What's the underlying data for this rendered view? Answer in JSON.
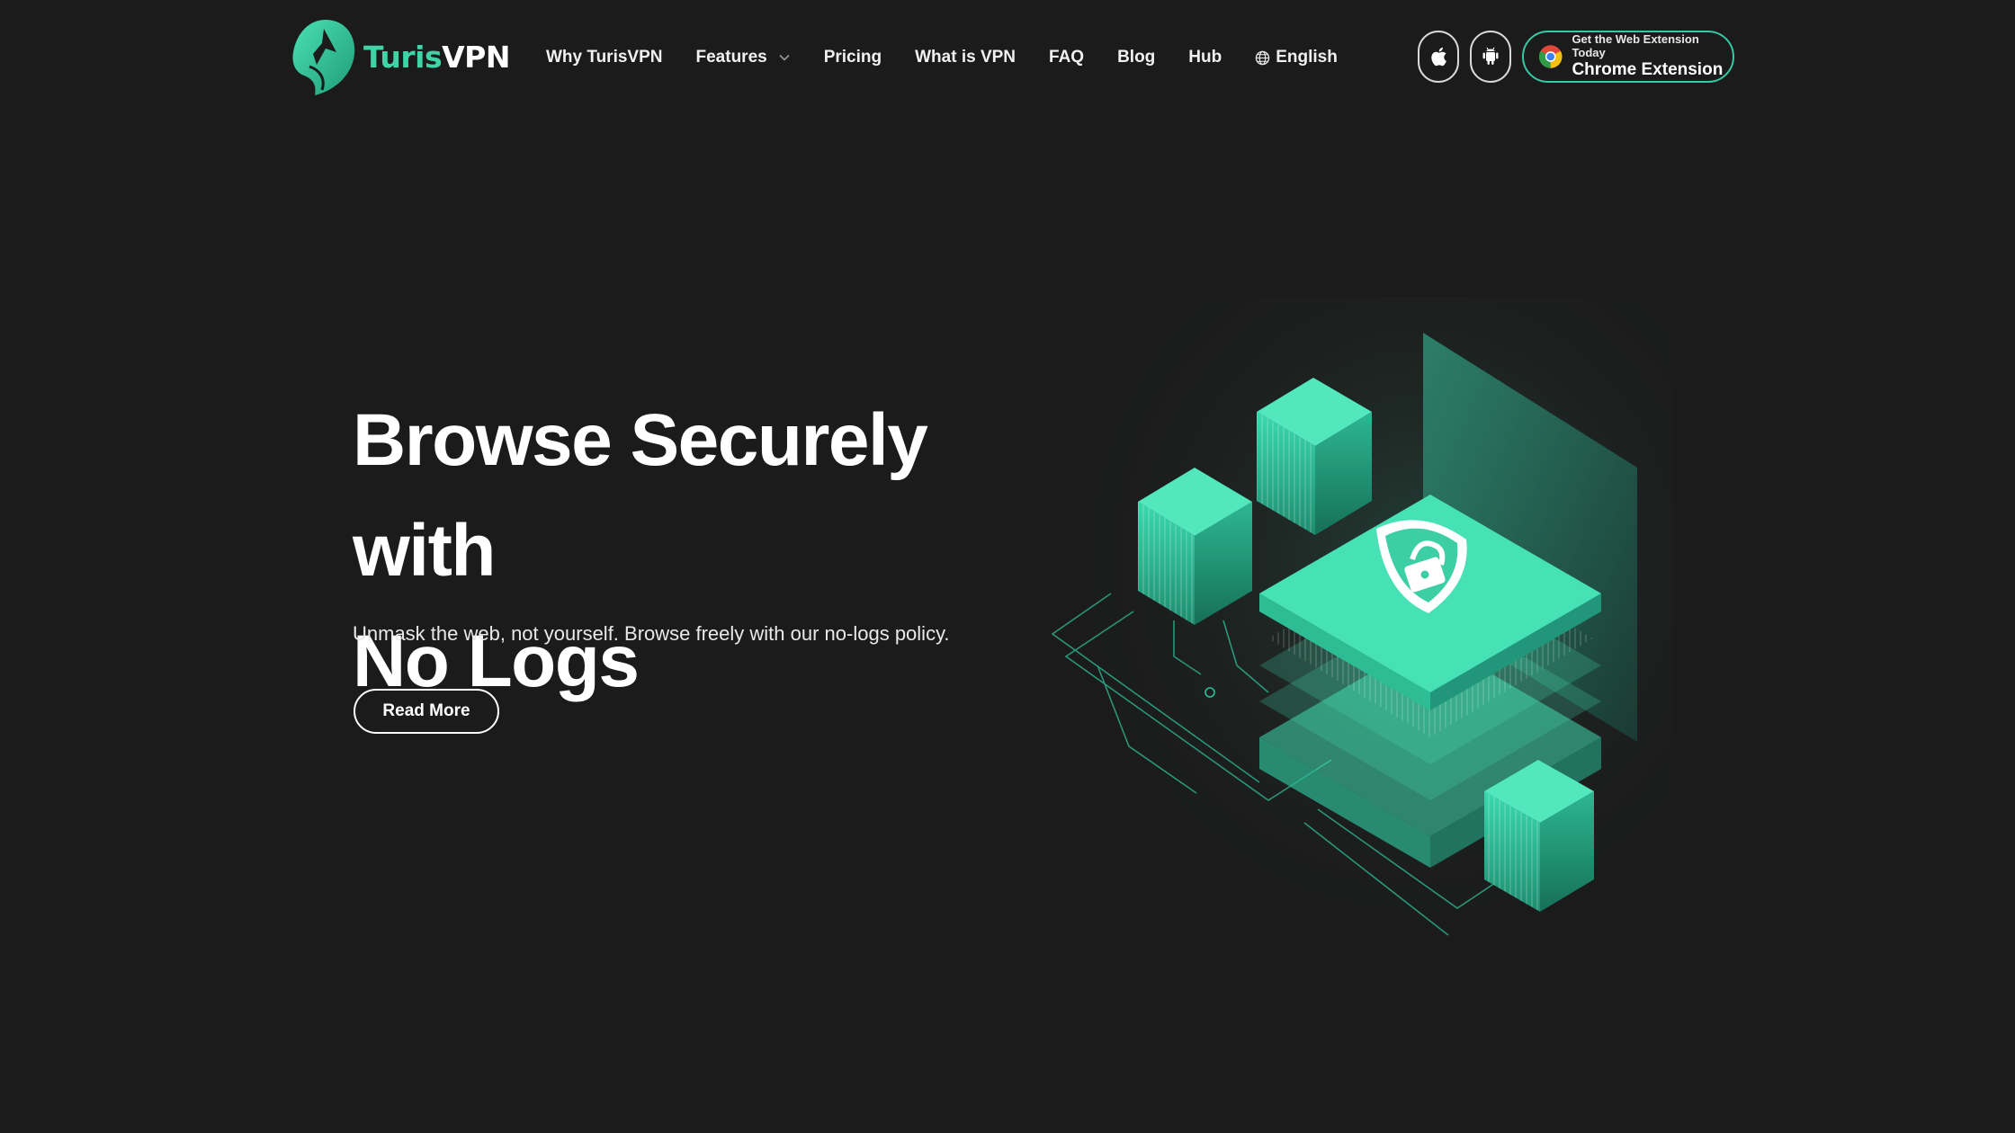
{
  "brand": {
    "name_part_1": "Turis",
    "name_part_2": "VPN",
    "accent_color": "#3fd3a6"
  },
  "nav": {
    "items": [
      {
        "label": "Why TurisVPN"
      },
      {
        "label": "Features",
        "has_dropdown": true,
        "icon": "chevron-down-icon"
      },
      {
        "label": "Pricing"
      },
      {
        "label": "What is VPN"
      },
      {
        "label": "FAQ"
      },
      {
        "label": "Blog"
      },
      {
        "label": "Hub"
      }
    ],
    "language": {
      "label": "English",
      "icon": "globe-icon"
    }
  },
  "actions": {
    "apple_icon": "apple-icon",
    "android_icon": "android-icon",
    "extension": {
      "subtitle": "Get the Web Extension Today",
      "title": "Chrome Extension",
      "icon": "chrome-icon"
    }
  },
  "hero": {
    "title_line_1": "Browse Securely with",
    "title_line_2": "No Logs",
    "subtitle": "Unmask the web, not yourself. Browse freely with our no-logs policy.",
    "cta_label": "Read More"
  },
  "colors": {
    "background": "#1b1b1b",
    "accent": "#36d6a8",
    "extension_border": "#36c9a3"
  }
}
